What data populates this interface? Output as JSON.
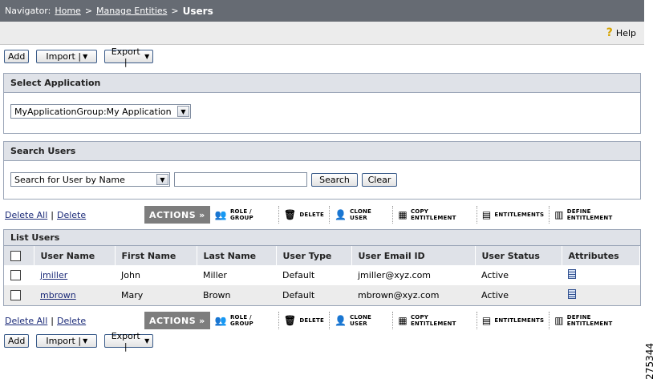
{
  "breadcrumb": {
    "label": "Navigator:",
    "home": "Home",
    "manage": "Manage Entities",
    "current": "Users",
    "separator": ">"
  },
  "help": {
    "label": "Help"
  },
  "top_buttons": {
    "add": "Add",
    "import": "Import |",
    "export": "Export |"
  },
  "select_application": {
    "title": "Select Application",
    "selected": "MyApplicationGroup:My Application"
  },
  "search_users": {
    "title": "Search Users",
    "mode": "Search for User by Name",
    "value": "",
    "search_label": "Search",
    "clear_label": "Clear"
  },
  "actions": {
    "delete_all": "Delete All",
    "divider": "|",
    "delete": "Delete",
    "label": "ACTIONS",
    "items": [
      "ROLE / GROUP",
      "DELETE",
      "CLONE USER",
      "COPY ENTITLEMENT",
      "ENTITLEMENTS",
      "DEFINE ENTITLEMENT"
    ]
  },
  "list_users": {
    "title": "List Users",
    "columns": [
      "User Name",
      "First Name",
      "Last Name",
      "User Type",
      "User Email ID",
      "User Status",
      "Attributes"
    ],
    "rows": [
      {
        "user_name": "jmiller",
        "first": "John",
        "last": "Miller",
        "type": "Default",
        "email": "jmiller@xyz.com",
        "status": "Active"
      },
      {
        "user_name": "mbrown",
        "first": "Mary",
        "last": "Brown",
        "type": "Default",
        "email": "mbrown@xyz.com",
        "status": "Active"
      }
    ]
  },
  "figure_id": "275344",
  "icons": {
    "help": "help-icon",
    "role": "role-group-icon",
    "delete": "trash-icon",
    "clone": "clone-user-icon",
    "copy": "copy-entitlement-icon",
    "entitlements": "entitlements-icon",
    "define": "define-entitlement-icon",
    "attributes": "attributes-icon"
  }
}
